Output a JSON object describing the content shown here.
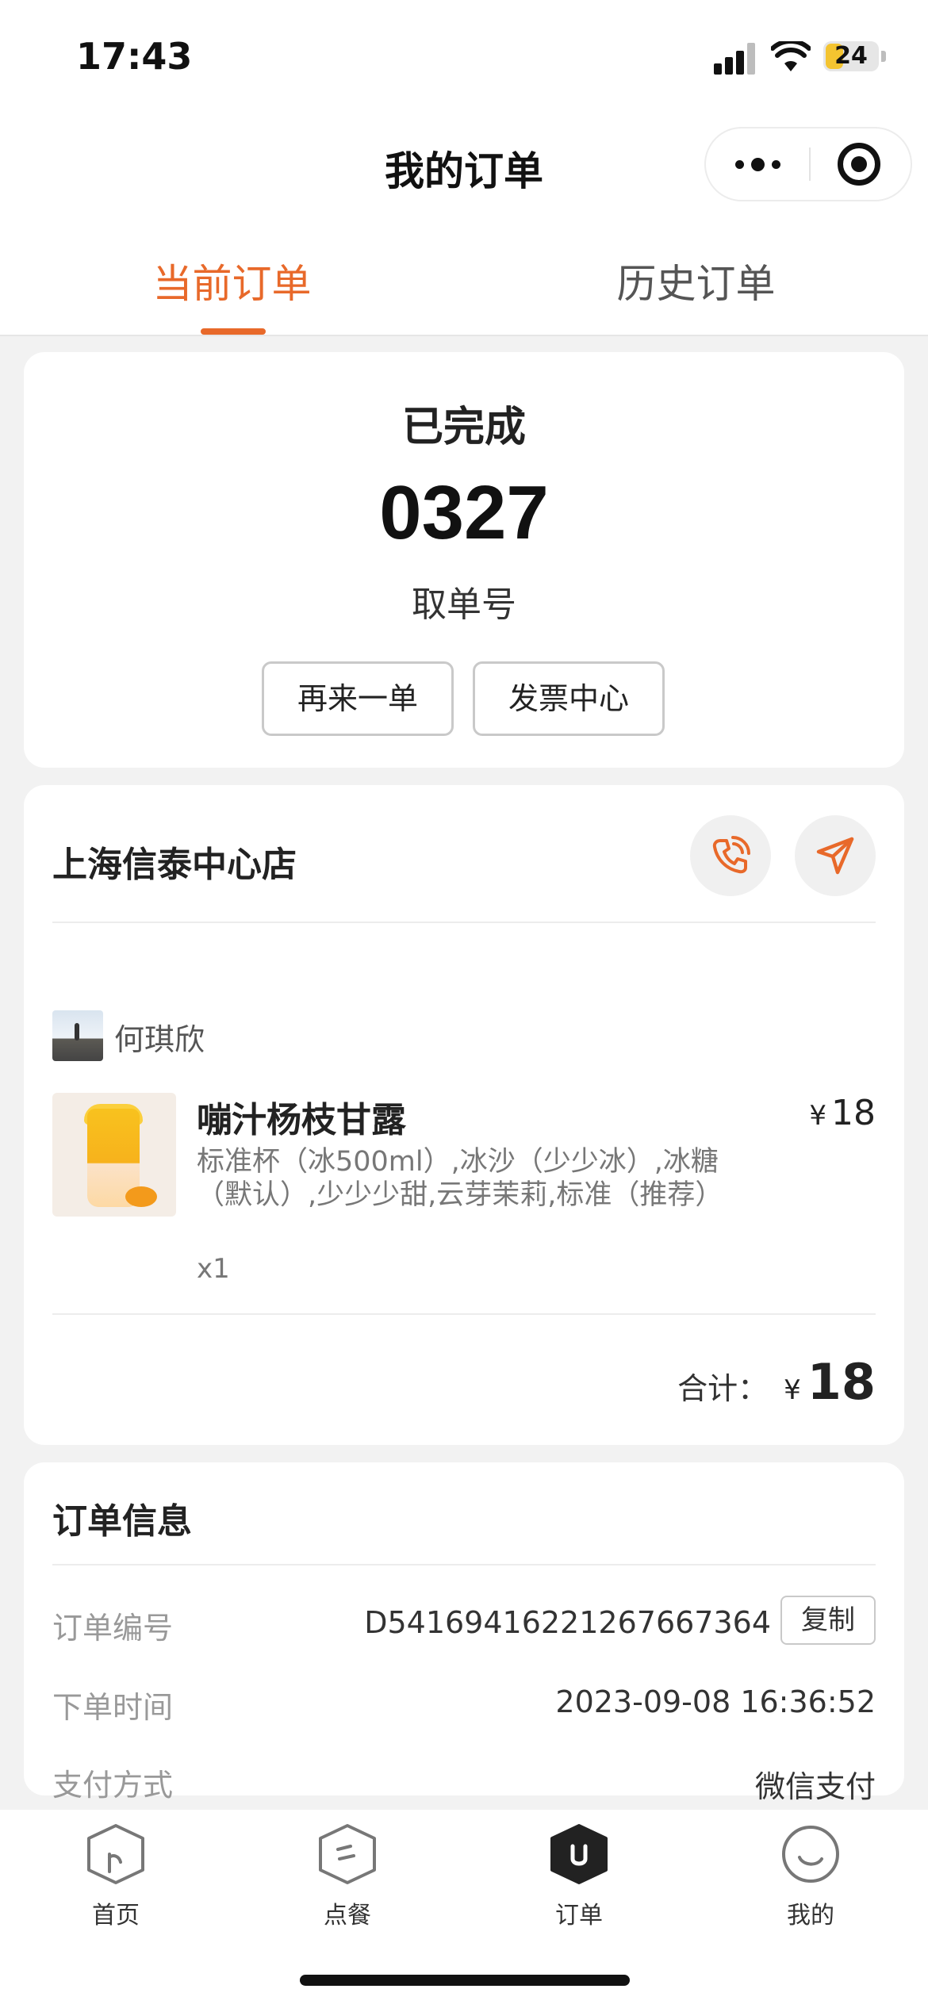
{
  "status_bar": {
    "time": "17:43",
    "battery": "24"
  },
  "nav": {
    "title": "我的订单"
  },
  "tabs": [
    {
      "label": "当前订单",
      "active": true
    },
    {
      "label": "历史订单",
      "active": false
    }
  ],
  "order_status": {
    "status": "已完成",
    "pickup_number": "0327",
    "pickup_label": "取单号",
    "reorder_label": "再来一单",
    "invoice_label": "发票中心"
  },
  "store": {
    "name": "上海信泰中心店",
    "buyer_name": "何琪欣",
    "items": [
      {
        "name": "嘣汁杨枝甘露",
        "price_symbol": "¥",
        "price": "18",
        "spec": "标准杯（冰500ml）,冰沙（少少冰）,冰糖（默认）,少少少甜,云芽茉莉,标准（推荐）",
        "quantity": "x1"
      }
    ],
    "total_label": "合计：",
    "total_symbol": "¥",
    "total_amount": "18"
  },
  "order_info": {
    "title": "订单信息",
    "rows": [
      {
        "label": "订单编号",
        "value": "D5416941622126766736​4"
      },
      {
        "label": "下单时间",
        "value": "2023-09-08 16:36:52"
      },
      {
        "label": "支付方式",
        "value": "微信支付"
      }
    ],
    "copy_label": "复制"
  },
  "tabbar": [
    {
      "label": "首页",
      "icon": "home-icon"
    },
    {
      "label": "点餐",
      "icon": "menu-icon"
    },
    {
      "label": "订单",
      "icon": "orders-icon",
      "active": true
    },
    {
      "label": "我的",
      "icon": "profile-icon"
    }
  ],
  "colors": {
    "accent": "#e8692a",
    "background": "#f2f2f2"
  }
}
